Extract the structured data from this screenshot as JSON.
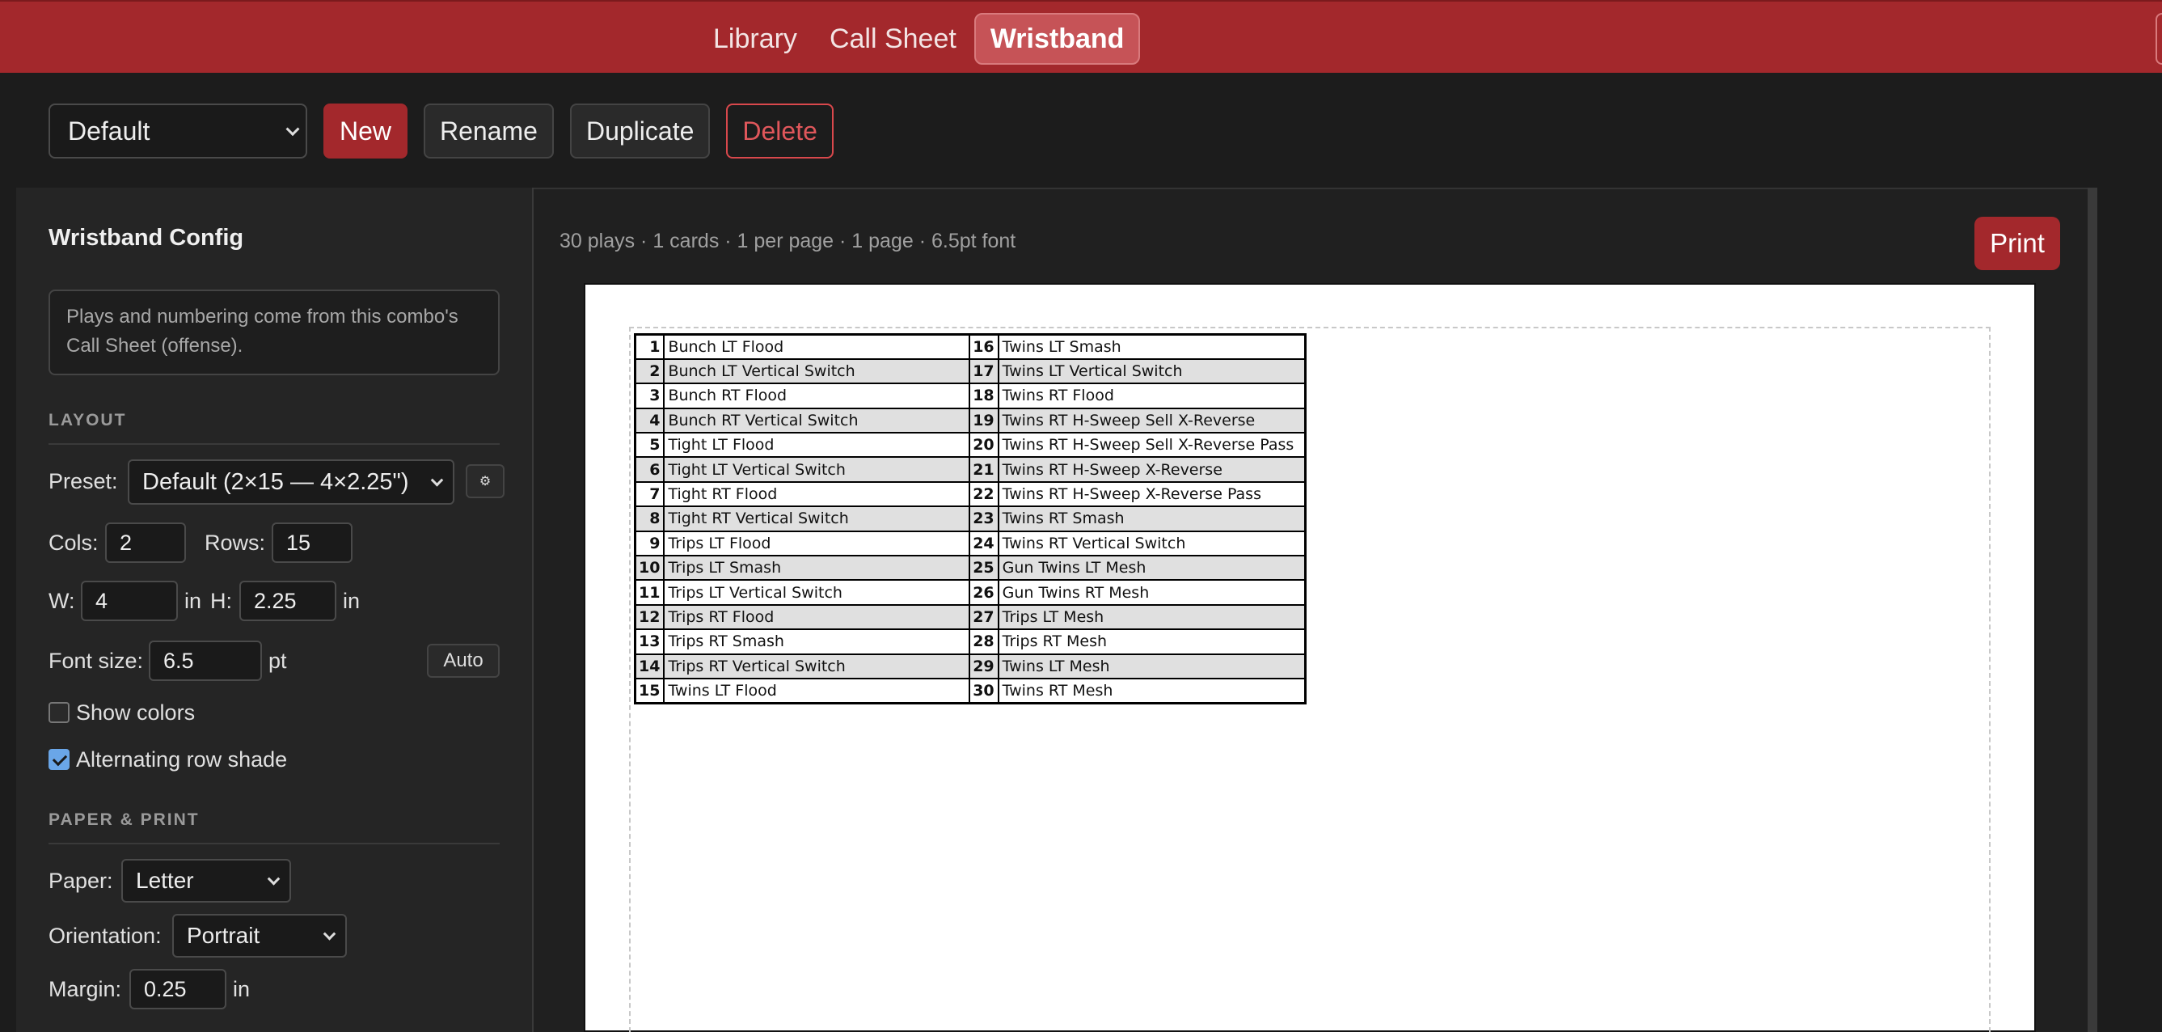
{
  "nav": {
    "tabs": [
      {
        "label": "Library",
        "active": false
      },
      {
        "label": "Call Sheet",
        "active": false
      },
      {
        "label": "Wristband",
        "active": true
      }
    ]
  },
  "toolbar": {
    "combo_select": "Default",
    "new_label": "New",
    "rename_label": "Rename",
    "duplicate_label": "Duplicate",
    "delete_label": "Delete"
  },
  "sidebar": {
    "title": "Wristband Config",
    "info": "Plays and numbering come from this combo's Call Sheet (offense).",
    "layout_heading": "LAYOUT",
    "preset_label": "Preset:",
    "preset_value": "Default (2×15 — 4×2.25\")",
    "cols_label": "Cols:",
    "cols_value": "2",
    "rows_label": "Rows:",
    "rows_value": "15",
    "w_label": "W:",
    "w_value": "4",
    "w_unit": "in",
    "h_label": "H:",
    "h_value": "2.25",
    "h_unit": "in",
    "font_size_label": "Font size:",
    "font_size_value": "6.5",
    "font_size_unit": "pt",
    "auto_label": "Auto",
    "show_colors_label": "Show colors",
    "show_colors_checked": false,
    "alt_shade_label": "Alternating row shade",
    "alt_shade_checked": true,
    "paper_heading": "PAPER & PRINT",
    "paper_label": "Paper:",
    "paper_value": "Letter",
    "orientation_label": "Orientation:",
    "orientation_value": "Portrait",
    "margin_label": "Margin:",
    "margin_value": "0.25",
    "margin_unit": "in"
  },
  "preview": {
    "summary": "30 plays · 1 cards · 1 per page · 1 page · 6.5pt font",
    "print_label": "Print",
    "rows": [
      {
        "n1": "1",
        "p1": "Bunch LT Flood",
        "n2": "16",
        "p2": "Twins LT Smash"
      },
      {
        "n1": "2",
        "p1": "Bunch LT Vertical Switch",
        "n2": "17",
        "p2": "Twins LT Vertical Switch"
      },
      {
        "n1": "3",
        "p1": "Bunch RT Flood",
        "n2": "18",
        "p2": "Twins RT Flood"
      },
      {
        "n1": "4",
        "p1": "Bunch RT Vertical Switch",
        "n2": "19",
        "p2": "Twins RT H-Sweep Sell X-Reverse"
      },
      {
        "n1": "5",
        "p1": "Tight LT Flood",
        "n2": "20",
        "p2": "Twins RT H-Sweep Sell X-Reverse Pass"
      },
      {
        "n1": "6",
        "p1": "Tight LT Vertical Switch",
        "n2": "21",
        "p2": "Twins RT H-Sweep X-Reverse"
      },
      {
        "n1": "7",
        "p1": "Tight RT Flood",
        "n2": "22",
        "p2": "Twins RT H-Sweep X-Reverse Pass"
      },
      {
        "n1": "8",
        "p1": "Tight RT Vertical Switch",
        "n2": "23",
        "p2": "Twins RT Smash"
      },
      {
        "n1": "9",
        "p1": "Trips LT Flood",
        "n2": "24",
        "p2": "Twins RT Vertical Switch"
      },
      {
        "n1": "10",
        "p1": "Trips LT Smash",
        "n2": "25",
        "p2": "Gun Twins LT Mesh"
      },
      {
        "n1": "11",
        "p1": "Trips LT Vertical Switch",
        "n2": "26",
        "p2": "Gun Twins RT Mesh"
      },
      {
        "n1": "12",
        "p1": "Trips RT Flood",
        "n2": "27",
        "p2": "Trips LT Mesh"
      },
      {
        "n1": "13",
        "p1": "Trips RT Smash",
        "n2": "28",
        "p2": "Trips RT Mesh"
      },
      {
        "n1": "14",
        "p1": "Trips RT Vertical Switch",
        "n2": "29",
        "p2": "Twins LT Mesh"
      },
      {
        "n1": "15",
        "p1": "Twins LT Flood",
        "n2": "30",
        "p2": "Twins RT Mesh"
      }
    ]
  }
}
